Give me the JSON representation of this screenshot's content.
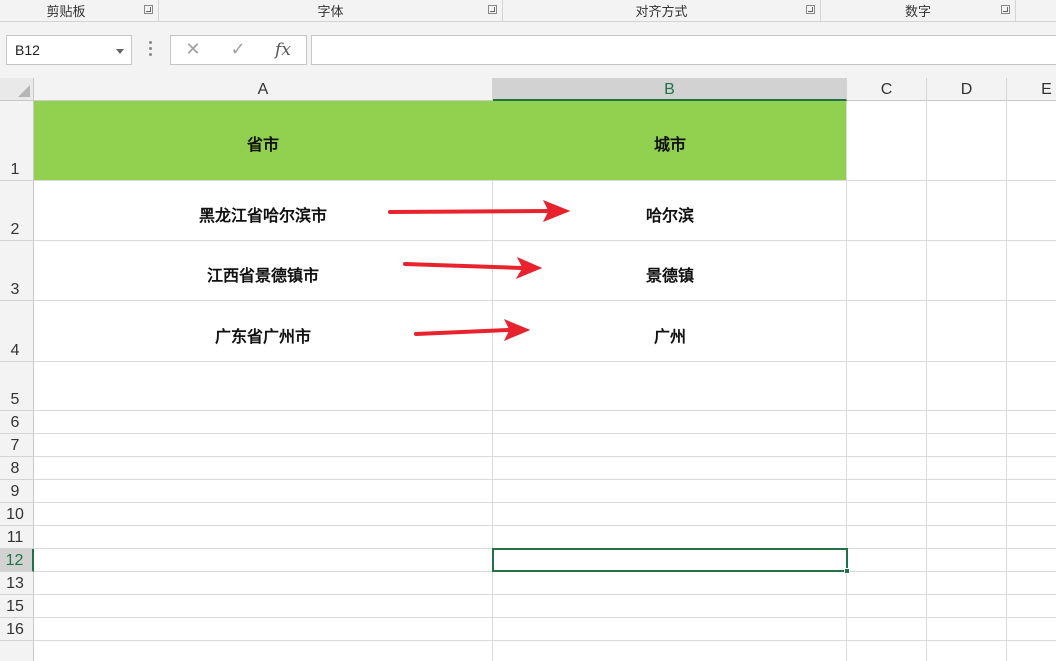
{
  "ribbon": {
    "groups": [
      "剪贴板",
      "字体",
      "对齐方式",
      "数字"
    ]
  },
  "formula_bar": {
    "name_box": "B12",
    "cancel_icon": "✕",
    "enter_icon": "✓",
    "function_label": "fx",
    "value": ""
  },
  "columns": [
    "A",
    "B",
    "C",
    "D",
    "E"
  ],
  "selected_column": "B",
  "rows": [
    "1",
    "2",
    "3",
    "4",
    "5",
    "6",
    "7",
    "8",
    "9",
    "10",
    "11",
    "12",
    "13",
    "15",
    "16"
  ],
  "selected_row": "12",
  "table": {
    "header": {
      "a": "省市",
      "b": "城市"
    },
    "data": [
      {
        "a": "黑龙江省哈尔滨市",
        "b": "哈尔滨"
      },
      {
        "a": "江西省景德镇市",
        "b": "景德镇"
      },
      {
        "a": "广东省广州市",
        "b": "广州"
      }
    ]
  },
  "colors": {
    "header_fill": "#92d050",
    "arrow": "#e8232d",
    "selection": "#217346"
  }
}
